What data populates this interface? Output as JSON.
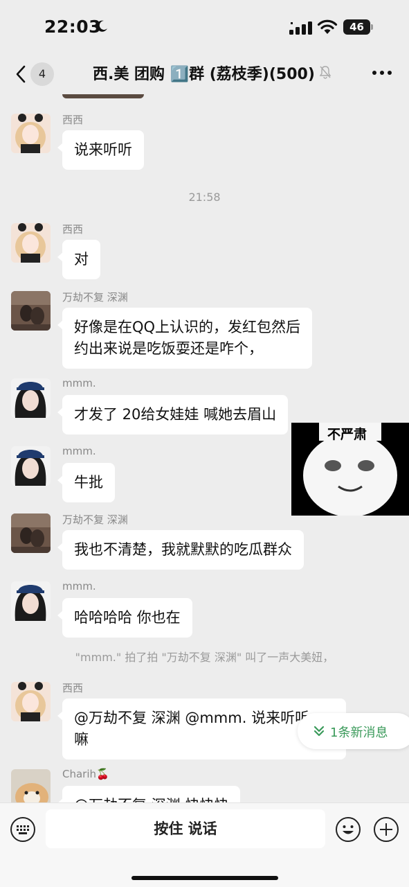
{
  "status_bar": {
    "time": "22:03",
    "battery": "46"
  },
  "nav": {
    "back_count": "4",
    "title": "西.美 团购 1️⃣群 (荔枝季)(500)"
  },
  "chat": {
    "messages": [
      {
        "sender": "西西",
        "lines": [
          "说来听听"
        ]
      },
      {
        "sender": "西西",
        "lines": [
          "对"
        ]
      },
      {
        "sender": "万劫不复   深渊",
        "lines": [
          "好像是在QQ上认识的，发红包然后",
          "约出来说是吃饭耍还是咋个，"
        ]
      },
      {
        "sender": "mmm.",
        "lines": [
          "才发了 20给女娃娃 喊她去眉山"
        ]
      },
      {
        "sender": "mmm.",
        "lines": [
          "牛批"
        ]
      },
      {
        "sender": "万劫不复   深渊",
        "lines": [
          "我也不清楚，我就默默的吃瓜群众"
        ]
      },
      {
        "sender": "mmm.",
        "lines": [
          "哈哈哈哈 你也在"
        ]
      },
      {
        "sender": "西西",
        "lines": [
          "@万劫不复   深渊 @mmm. 说来听听",
          "嘛"
        ]
      },
      {
        "sender": "Charih🍒",
        "lines": [
          "@万劫不复   深渊 快快快"
        ]
      }
    ],
    "time_divider": "21:58",
    "system_note": "\"mmm.\" 拍了拍 \"万劫不复   深渊\" 叫了一声大美妞，",
    "sticker_caption": "不严肃",
    "new_messages": "1条新消息"
  },
  "input_bar": {
    "hold_to_talk": "按住 说话"
  },
  "colors": {
    "background": "#ededed",
    "bubble": "#ffffff",
    "new_message_accent": "#3a9a5a",
    "meta_text": "#888888"
  }
}
